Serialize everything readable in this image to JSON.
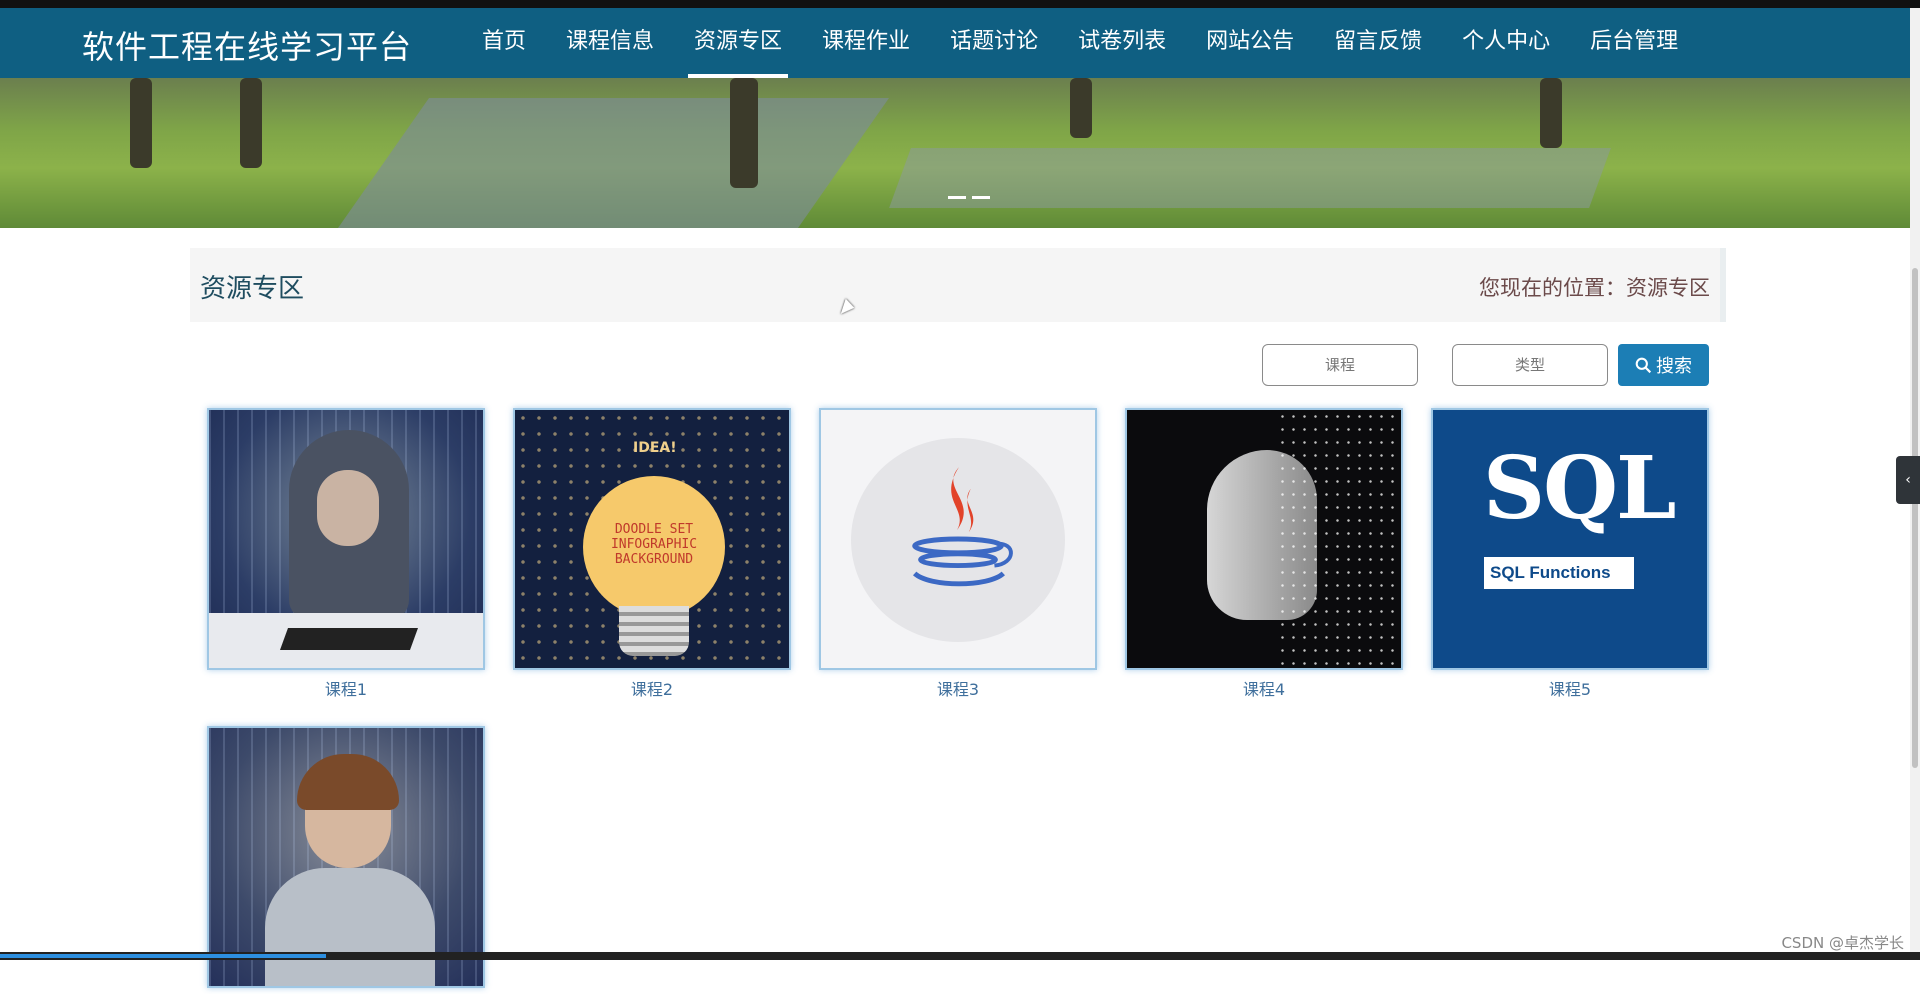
{
  "brand": {
    "title": "软件工程在线学习平台"
  },
  "nav": {
    "items": [
      {
        "label": "首页"
      },
      {
        "label": "课程信息"
      },
      {
        "label": "资源专区",
        "active": true
      },
      {
        "label": "课程作业"
      },
      {
        "label": "话题讨论"
      },
      {
        "label": "试卷列表"
      },
      {
        "label": "网站公告"
      },
      {
        "label": "留言反馈"
      },
      {
        "label": "个人中心"
      },
      {
        "label": "后台管理"
      }
    ]
  },
  "section": {
    "title": "资源专区",
    "breadcrumb": "您现在的位置：资源专区"
  },
  "search": {
    "course_placeholder": "课程",
    "type_placeholder": "类型",
    "button_label": "搜索"
  },
  "resources": [
    {
      "label": "课程1",
      "thumb": "hacker-photo"
    },
    {
      "label": "课程2",
      "thumb": "lightbulb-doodle",
      "text": "DOODLE SET INFOGRAPHIC BACKGROUND",
      "idea": "IDEA!"
    },
    {
      "label": "课程3",
      "thumb": "java-logo"
    },
    {
      "label": "课程4",
      "thumb": "ai-robot-head"
    },
    {
      "label": "课程5",
      "thumb": "sql-functions",
      "big": "SQL",
      "box": "SQL Functions"
    },
    {
      "label": "",
      "thumb": "kid-coder-photo"
    }
  ],
  "video_progress": 0.17,
  "watermark": "CSDN @卓杰学长",
  "colors": {
    "navbar": "#0f5f82",
    "search_button": "#1c7eb5",
    "card_label": "#3f6f9c"
  }
}
